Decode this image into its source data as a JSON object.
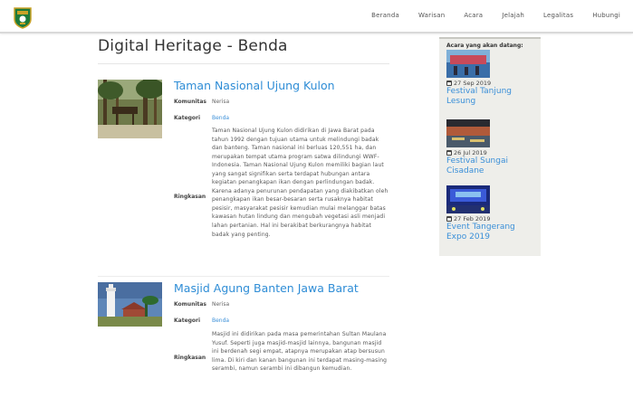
{
  "nav": {
    "items": [
      "Beranda",
      "Warisan",
      "Acara",
      "Jelajah",
      "Legalitas",
      "Hubungi"
    ]
  },
  "page": {
    "title": "Digital Heritage - Benda"
  },
  "heritage_items": [
    {
      "title": "Taman Nasional Ujung Kulon",
      "komunitas_label": "Komunitas",
      "komunitas_value": "Nerisa",
      "kategori_label": "Kategori",
      "kategori_value": "Benda",
      "ringkasan_label": "Ringkasan",
      "ringkasan": "Taman Nasional Ujung Kulon didirikan di Jawa Barat pada tahun 1992 dengan tujuan utama untuk melindungi badak dan banteng. Taman nasional ini berluas 120,551 ha, dan merupakan tempat utama program satwa dilindungi WWF-Indonesia. Taman Nasional Ujung Kulon memiliki bagian laut yang sangat signifikan serta terdapat hubungan antara kegiatan penangkapan ikan dengan perlindungan badak. Karena adanya penurunan pendapatan yang diakibatkan oleh penangkapan ikan besar-besaran serta rusaknya habitat pesisir, masyarakat pesisir kemudian mulai melanggar batas kawasan hutan lindung dan mengubah vegetasi asli menjadi lahan pertanian. Hal ini berakibat berkurangnya habitat badak yang penting."
    },
    {
      "title": "Masjid Agung Banten Jawa Barat",
      "komunitas_label": "Komunitas",
      "komunitas_value": "Nerisa",
      "kategori_label": "Kategori",
      "kategori_value": "Benda",
      "ringkasan_label": "Ringkasan",
      "ringkasan": "Masjid ini didirikan pada masa pemerintahan Sultan Maulana Yusuf. Seperti juga masjid-masjid lainnya, bangunan masjid ini berdenah segi empat, atapnya merupakan atap bersusun lima. Di kiri dan kanan bangunan ini terdapat masing-masing serambi, namun serambi ini dibangun kemudian."
    }
  ],
  "sidebar": {
    "heading": "Acara yang akan datang:",
    "events": [
      {
        "date": "27 Sep 2019",
        "title": "Festival Tanjung Lesung"
      },
      {
        "date": "26 Jul 2019",
        "title": "Festival Sungai Cisadane"
      },
      {
        "date": "27 Feb 2019",
        "title": "Event Tangerang Expo 2019"
      }
    ]
  },
  "colors": {
    "link": "#3a8fd8",
    "title_link": "#2f8dd6",
    "sidebar_bg": "#eeeeea"
  }
}
